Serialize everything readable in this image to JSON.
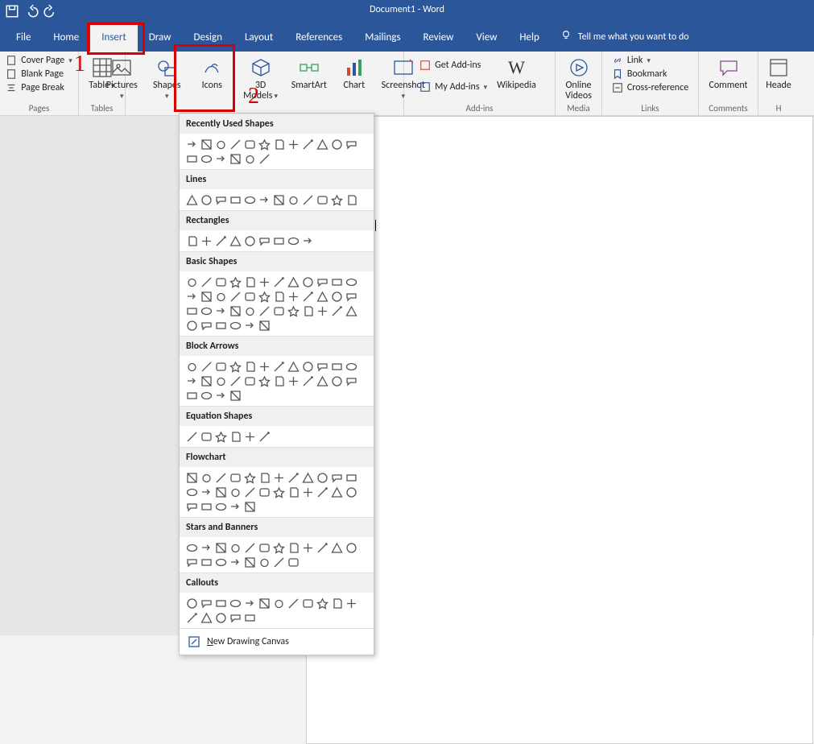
{
  "app_title": "Document1  -  Word",
  "tabs": [
    "File",
    "Home",
    "Insert",
    "Draw",
    "Design",
    "Layout",
    "References",
    "Mailings",
    "Review",
    "View",
    "Help"
  ],
  "tell_me": "Tell me what you want to do",
  "pages_group": {
    "label": "Pages",
    "cover": "Cover Page",
    "blank": "Blank Page",
    "page_break": "Page Break"
  },
  "tables_group": {
    "label": "Tables",
    "table": "Table"
  },
  "illust_group": {
    "pictures": "Pictures",
    "shapes": "Shapes",
    "icons": "Icons",
    "models": "3D Models",
    "smartart": "SmartArt",
    "chart": "Chart",
    "screenshot": "Screenshot"
  },
  "addins_group": {
    "label": "Add-ins",
    "get": "Get Add-ins",
    "my": "My Add-ins",
    "wiki": "Wikipedia"
  },
  "media_group": {
    "label": "Media",
    "online": "Online Videos"
  },
  "links_group": {
    "label": "Links",
    "link": "Link",
    "bookmark": "Bookmark",
    "xref": "Cross-reference"
  },
  "comments_group": {
    "label": "Comments",
    "comment": "Comment"
  },
  "header_group": {
    "label": "H",
    "header": "Heade"
  },
  "annotations": {
    "num1": "1",
    "num2": "2"
  },
  "shapes_menu": {
    "categories": [
      {
        "name": "Recently Used Shapes",
        "count": 18
      },
      {
        "name": "Lines",
        "count": 12
      },
      {
        "name": "Rectangles",
        "count": 9
      },
      {
        "name": "Basic Shapes",
        "count": 42
      },
      {
        "name": "Block Arrows",
        "count": 28
      },
      {
        "name": "Equation Shapes",
        "count": 6
      },
      {
        "name": "Flowchart",
        "count": 29
      },
      {
        "name": "Stars and Banners",
        "count": 20
      },
      {
        "name": "Callouts",
        "count": 17
      }
    ],
    "new_canvas": "New Drawing Canvas"
  }
}
